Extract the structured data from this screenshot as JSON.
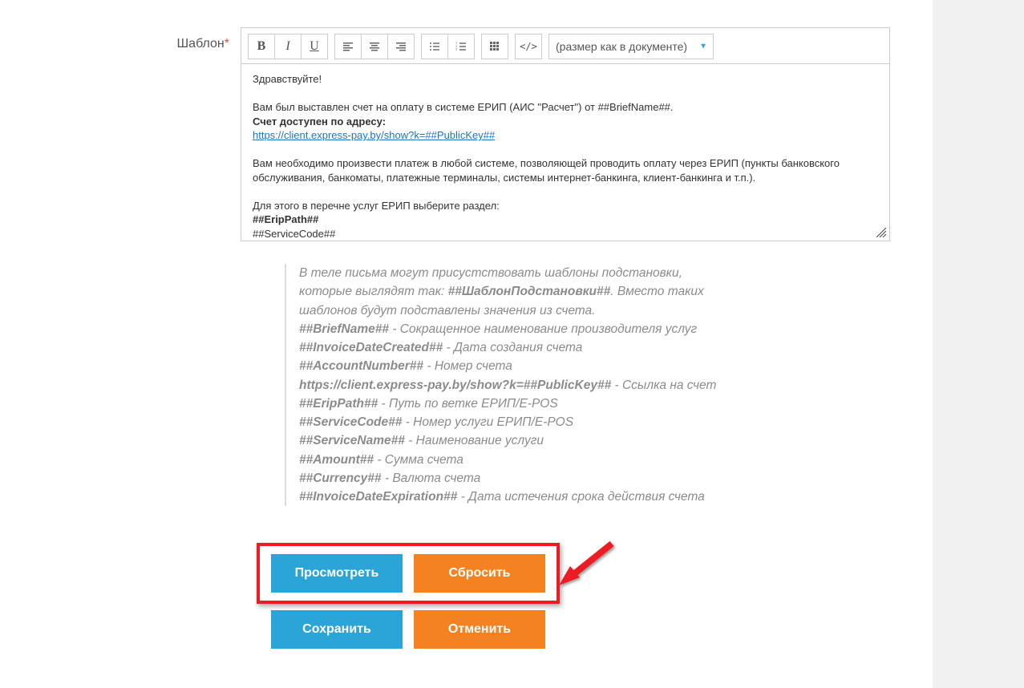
{
  "label": {
    "text": "Шаблон",
    "required": "*"
  },
  "toolbar": {
    "bold": "B",
    "italic": "I",
    "underline": "U",
    "code_label": "</>",
    "font_size_selected": "(размер как в документе)"
  },
  "editor": {
    "line1": "Здравствуйте!",
    "line2": "Вам был выставлен счет на оплату в системе ЕРИП (АИС \"Расчет\") от ##BriefName##.",
    "line3": "Счет доступен по адресу:",
    "link": "https://client.express-pay.by/show?k=##PublicKey##",
    "line4": "Вам необходимо произвести платеж в любой системе, позволяющей проводить оплату через ЕРИП (пункты банковского обслуживания, банкоматы, платежные терминалы, системы интернет-банкинга, клиент-банкинга и т.п.).",
    "line5": "Для этого в перечне услуг ЕРИП выберите раздел:",
    "line6": "##EripPath##",
    "line7": "##ServiceCode##"
  },
  "help": {
    "intro1": "В теле письма могут присуcтствовать шаблоны подстановки,",
    "intro2_a": "которые выглядят так: ",
    "intro2_b": "##ШаблонПодстановки##",
    "intro2_c": ". Вместо таких",
    "intro3": "шаблонов будут подставлены значения из счета.",
    "r1a": "##BriefName##",
    "r1b": " - Сокращенное наименование производителя услуг",
    "r2a": "##InvoiceDateCreated##",
    "r2b": " - Дата создания счета",
    "r3a": "##AccountNumber##",
    "r3b": " - Номер счета",
    "r4a": "https://client.express-pay.by/show?k=##PublicKey##",
    "r4b": " - Ссылка на счет",
    "r5a": "##EripPath##",
    "r5b": " - Путь по ветке ЕРИП/E-POS",
    "r6a": "##ServiceCode##",
    "r6b": " - Номер услуги ЕРИП/E-POS",
    "r7a": "##ServiceName##",
    "r7b": " - Наименование услуги",
    "r8a": "##Amount##",
    "r8b": " - Сумма счета",
    "r9a": "##Currency##",
    "r9b": " - Валюта счета",
    "r10a": "##InvoiceDateExpiration##",
    "r10b": " - Дата истечения срока действия счета"
  },
  "buttons": {
    "preview": "Просмотреть",
    "reset": "Сбросить",
    "save": "Сохранить",
    "cancel": "Отменить"
  }
}
